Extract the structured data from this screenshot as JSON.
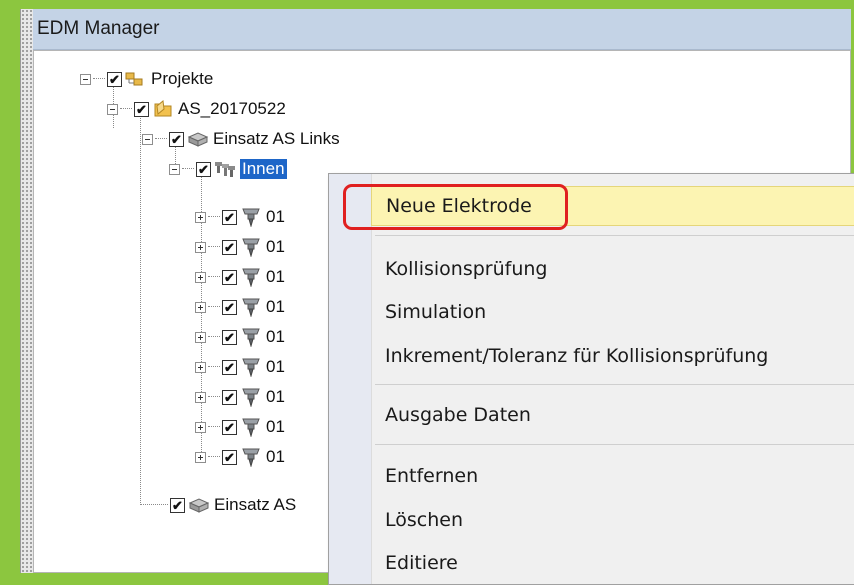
{
  "window": {
    "title": "EDM Manager"
  },
  "tree": {
    "root": {
      "label": "Projekte",
      "checked": "✔",
      "expander": "minus"
    },
    "project": {
      "label": "AS_20170522",
      "checked": "✔",
      "expander": "minus"
    },
    "insert_left": {
      "label": "Einsatz AS Links",
      "checked": "✔",
      "expander": "minus"
    },
    "group_inner": {
      "label": "Innen",
      "checked": "✔",
      "expander": "minus",
      "selected": true
    },
    "electrodes": [
      {
        "label": "01",
        "checked": "✔"
      },
      {
        "label": "01",
        "checked": "✔"
      },
      {
        "label": "01",
        "checked": "✔"
      },
      {
        "label": "01",
        "checked": "✔"
      },
      {
        "label": "01",
        "checked": "✔"
      },
      {
        "label": "01",
        "checked": "✔"
      },
      {
        "label": "01",
        "checked": "✔"
      },
      {
        "label": "01",
        "checked": "✔"
      },
      {
        "label": "01",
        "checked": "✔"
      }
    ],
    "insert_right": {
      "label": "Einsatz AS",
      "checked": "✔"
    }
  },
  "context_menu": {
    "items": [
      {
        "label": "Neue Elektrode",
        "highlighted": true
      },
      {
        "label": "Kollisionsprüfung"
      },
      {
        "label": "Simulation"
      },
      {
        "label": "Inkrement/Toleranz für Kollisionsprüfung"
      },
      {
        "label": "Ausgabe Daten"
      },
      {
        "label": "Entfernen"
      },
      {
        "label": "Löschen"
      },
      {
        "label": "Editiere"
      }
    ]
  },
  "colors": {
    "frame_green": "#8cc63f",
    "selection_blue": "#1e66c8",
    "highlight_yellow": "#fcf4b2",
    "callout_red": "#e02020"
  }
}
